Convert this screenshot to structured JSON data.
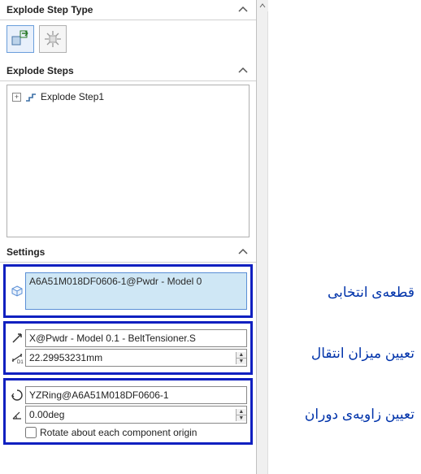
{
  "sections": {
    "explodeStepType": {
      "title": "Explode Step Type"
    },
    "explodeSteps": {
      "title": "Explode Steps",
      "item": "Explode Step1"
    },
    "settings": {
      "title": "Settings"
    }
  },
  "settings": {
    "selection": "A6A51M018DF0606-1@Pwdr - Model 0",
    "direction": "X@Pwdr - Model 0.1 - BeltTensioner.S",
    "distance": "22.29953231mm",
    "rotationRef": "YZRing@A6A51M018DF0606-1",
    "angle": "0.00deg",
    "rotateOriginLabel": "Rotate about each component origin"
  },
  "annotations": {
    "selection": "قطعه‌ی انتخابی",
    "translation": "تعیین میزان انتقال",
    "rotation": "تعیین زاویه‌ی دوران"
  },
  "icons": {
    "chevUp": "^"
  }
}
